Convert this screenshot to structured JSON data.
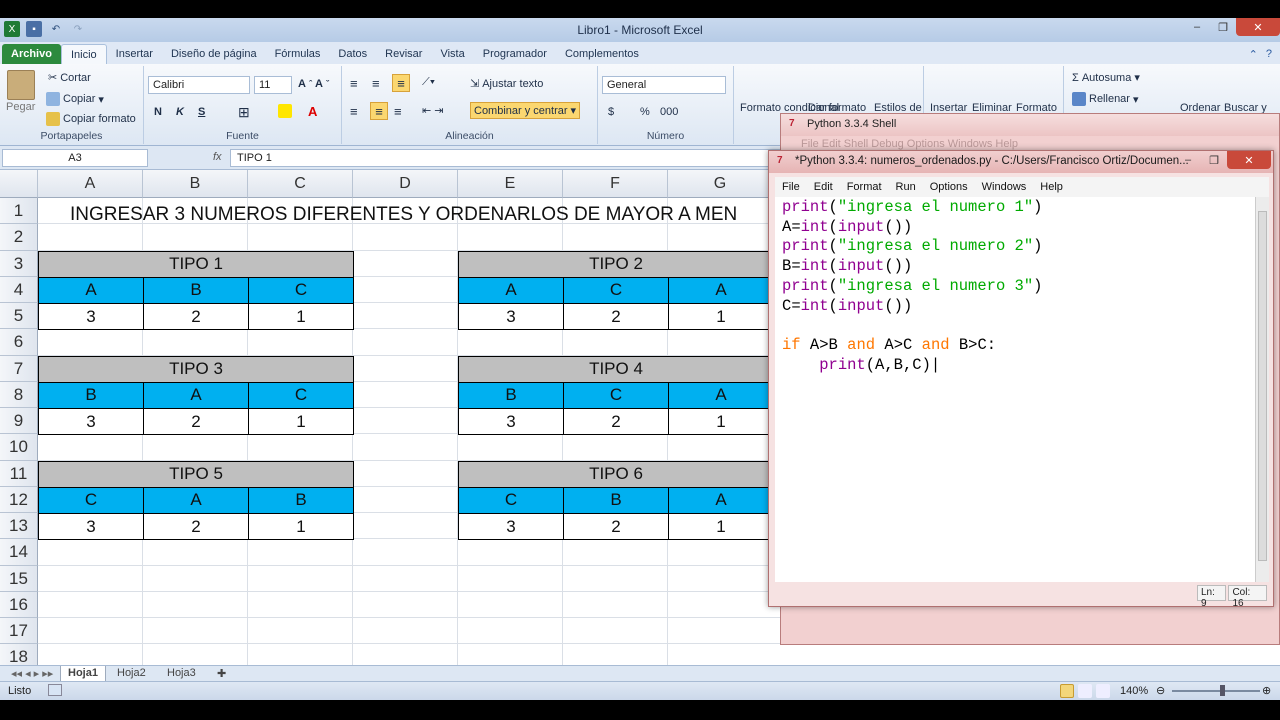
{
  "window": {
    "title": "Libro1 - Microsoft Excel"
  },
  "ribbon_tabs": [
    "Archivo",
    "Inicio",
    "Insertar",
    "Diseño de página",
    "Fórmulas",
    "Datos",
    "Revisar",
    "Vista",
    "Programador",
    "Complementos"
  ],
  "clipboard": {
    "paste": "Pegar",
    "cut": "Cortar",
    "copy": "Copiar",
    "format_painter": "Copiar formato",
    "label": "Portapapeles"
  },
  "font": {
    "name": "Calibri",
    "size": "11",
    "bold": "N",
    "italic": "K",
    "underline": "S",
    "label": "Fuente"
  },
  "alignment": {
    "wrap": "Ajustar texto",
    "merge": "Combinar y centrar",
    "label": "Alineación"
  },
  "number": {
    "format": "General",
    "currency": "$",
    "percent": "%",
    "thousands": "000",
    "label": "Número"
  },
  "styles": {
    "conditional": "Formato condicional",
    "as_table": "Dar formato",
    "cell_styles": "Estilos de"
  },
  "cells": {
    "insert": "Insertar",
    "delete": "Eliminar",
    "format": "Formato"
  },
  "editing": {
    "autosum": "Autosuma",
    "fill": "Rellenar",
    "sort": "Ordenar",
    "find": "Buscar y"
  },
  "formula_bar": {
    "name_box": "A3",
    "fx": "fx",
    "content": "TIPO 1"
  },
  "columns": [
    "A",
    "B",
    "C",
    "D",
    "E",
    "F",
    "G"
  ],
  "rows": [
    "1",
    "2",
    "3",
    "4",
    "5",
    "6",
    "7",
    "8",
    "9",
    "10",
    "11",
    "12",
    "13",
    "14",
    "15",
    "16",
    "17",
    "18"
  ],
  "heading": "INGRESAR 3 NUMEROS DIFERENTES Y ORDENARLOS DE MAYOR A MEN",
  "tables": [
    {
      "title": "TIPO 1",
      "headers": [
        "A",
        "B",
        "C"
      ],
      "values": [
        "3",
        "2",
        "1"
      ]
    },
    {
      "title": "TIPO 2",
      "headers": [
        "A",
        "C",
        "A"
      ],
      "values": [
        "3",
        "2",
        "1"
      ]
    },
    {
      "title": "TIPO 3",
      "headers": [
        "B",
        "A",
        "C"
      ],
      "values": [
        "3",
        "2",
        "1"
      ]
    },
    {
      "title": "TIPO 4",
      "headers": [
        "B",
        "C",
        "A"
      ],
      "values": [
        "3",
        "2",
        "1"
      ]
    },
    {
      "title": "TIPO 5",
      "headers": [
        "C",
        "A",
        "B"
      ],
      "values": [
        "3",
        "2",
        "1"
      ]
    },
    {
      "title": "TIPO 6",
      "headers": [
        "C",
        "B",
        "A"
      ],
      "values": [
        "3",
        "2",
        "1"
      ]
    }
  ],
  "sheets": [
    "Hoja1",
    "Hoja2",
    "Hoja3"
  ],
  "status": {
    "ready": "Listo",
    "zoom": "140%"
  },
  "shell": {
    "title": "Python 3.3.4 Shell",
    "menu_hint": "File  Edit  Shell  Debug  Options  Windows  Help"
  },
  "editor": {
    "title": "*Python 3.3.4: numeros_ordenados.py - C:/Users/Francisco Ortiz/Documen...",
    "menu": [
      "File",
      "Edit",
      "Format",
      "Run",
      "Options",
      "Windows",
      "Help"
    ],
    "code_lines": [
      "print(\"ingresa el numero 1\")",
      "A=int(input())",
      "print(\"ingresa el numero 2\")",
      "B=int(input())",
      "print(\"ingresa el numero 3\")",
      "C=int(input())",
      "",
      "if A>B and A>C and B>C:",
      "    print(A,B,C)"
    ],
    "ln": "Ln: 9",
    "col": "Col: 16"
  },
  "colors": {
    "header_gray": "#bfbfbf",
    "header_blue": "#00b0f0",
    "excel_green": "#2c8a3d"
  }
}
